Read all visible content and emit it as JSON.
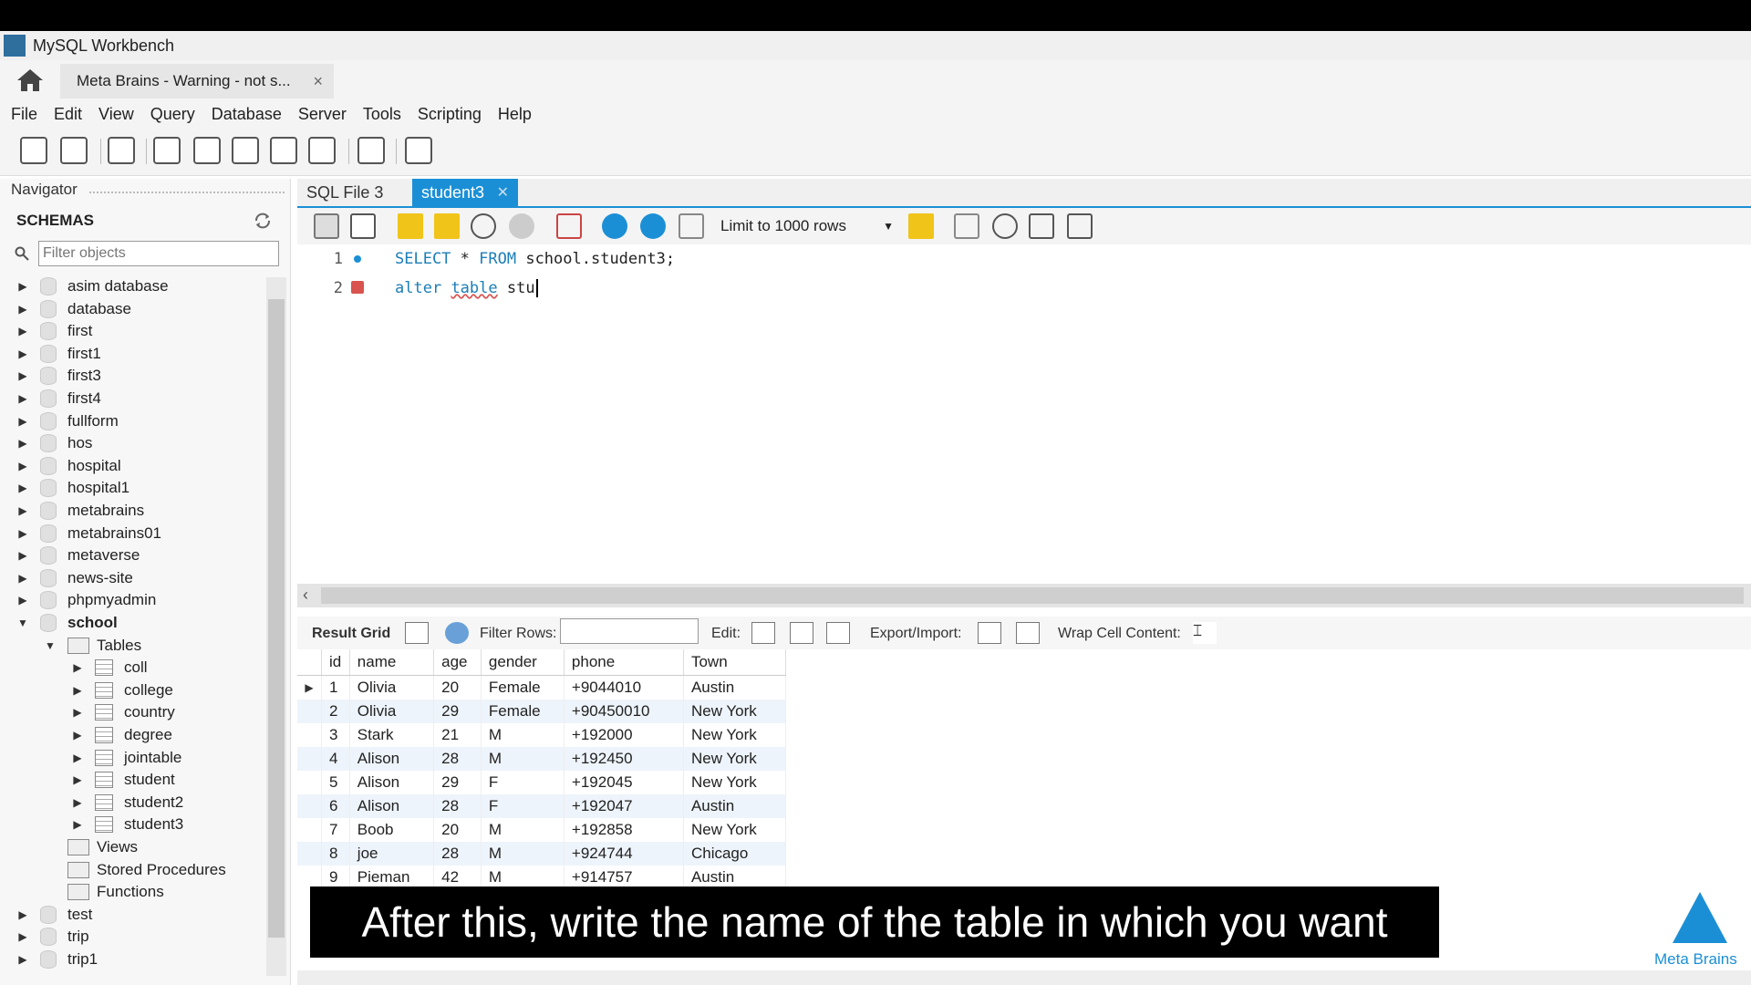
{
  "window": {
    "title": "MySQL Workbench"
  },
  "connection_tab": {
    "label": "Meta Brains - Warning - not s...",
    "close": "×"
  },
  "menu": [
    "File",
    "Edit",
    "View",
    "Query",
    "Database",
    "Server",
    "Tools",
    "Scripting",
    "Help"
  ],
  "navigator": {
    "title": "Navigator",
    "schemas_heading": "SCHEMAS",
    "filter_placeholder": "Filter objects",
    "schemas": [
      "asim database",
      "database",
      "first",
      "first1",
      "first3",
      "first4",
      "fullform",
      "hos",
      "hospital",
      "hospital1",
      "metabrains",
      "metabrains01",
      "metaverse",
      "news-site",
      "phpmyadmin"
    ],
    "expanded_schema": "school",
    "tables_folder": "Tables",
    "tables": [
      "coll",
      "college",
      "country",
      "degree",
      "jointable",
      "student",
      "student2",
      "student3"
    ],
    "other_folders": [
      "Views",
      "Stored Procedures",
      "Functions"
    ],
    "schemas_after": [
      "test",
      "trip",
      "trip1"
    ]
  },
  "editor": {
    "tabs": [
      "SQL File 3",
      "student3"
    ],
    "active_tab": "student3",
    "limit_label": "Limit to 1000 rows",
    "lines": [
      {
        "num": "1",
        "kw1": "SELECT",
        "mid": " * ",
        "kw2": "FROM",
        "rest": " school.student3;"
      },
      {
        "num": "2",
        "kw1": "alter",
        "mid": " ",
        "kw2": "table",
        "rest": " stu"
      }
    ]
  },
  "result": {
    "result_grid_label": "Result Grid",
    "filter_rows_label": "Filter Rows:",
    "edit_label": "Edit:",
    "export_label": "Export/Import:",
    "wrap_label": "Wrap Cell Content:",
    "columns": [
      "id",
      "name",
      "age",
      "gender",
      "phone",
      "Town"
    ],
    "rows": [
      [
        "1",
        "Olivia",
        "20",
        "Female",
        "+9044010",
        "Austin"
      ],
      [
        "2",
        "Olivia",
        "29",
        "Female",
        "+90450010",
        "New York"
      ],
      [
        "3",
        "Stark",
        "21",
        "M",
        "+192000",
        "New York"
      ],
      [
        "4",
        "Alison",
        "28",
        "M",
        "+192450",
        "New York"
      ],
      [
        "5",
        "Alison",
        "29",
        "F",
        "+192045",
        "New York"
      ],
      [
        "6",
        "Alison",
        "28",
        "F",
        "+192047",
        "Austin"
      ],
      [
        "7",
        "Boob",
        "20",
        "M",
        "+192858",
        "New York"
      ],
      [
        "8",
        "joe",
        "28",
        "M",
        "+924744",
        "Chicago"
      ],
      [
        "9",
        "Pieman",
        "42",
        "M",
        "+914757",
        "Austin"
      ]
    ]
  },
  "subtitle": "After this, write the name of the table in which you want",
  "watermark": "Meta Brains",
  "colors": {
    "accent": "#1b8fd6",
    "keyword": "#1b7eb8",
    "error": "#d9534f"
  }
}
